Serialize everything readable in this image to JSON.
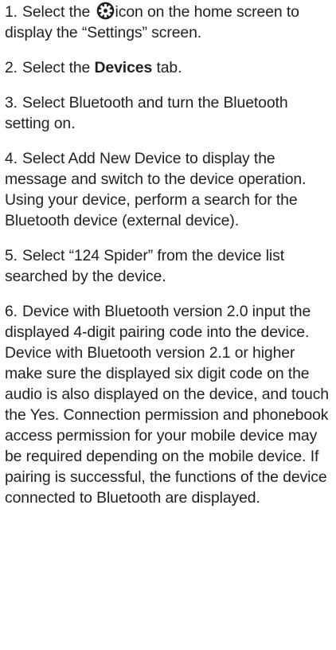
{
  "steps": [
    {
      "num": "1.",
      "pre": "Select the",
      "icon": "settings-gear-icon",
      "post": "icon on the home screen to display the “Settings” screen."
    },
    {
      "num": "2.",
      "pre": "Select the",
      "bold": "Devices",
      "post": "tab."
    },
    {
      "num": "3.",
      "text": "Select Bluetooth and turn the Bluetooth setting on."
    },
    {
      "num": "4.",
      "text": "Select Add New Device to display the message and switch to the device operation. Using your device, perform a search for the Bluetooth device (external device)."
    },
    {
      "num": "5.",
      "text": "Select “124 Spider” from the device list searched by the device."
    },
    {
      "num": "6.",
      "text": "Device with Bluetooth version 2.0 input the displayed 4-digit pairing code into the device. Device with Bluetooth version 2.1 or higher make sure the displayed six digit code on the audio is also displayed on the device, and touch the Yes. Connection permission and phonebook access permission for your mobile device may be required depending on the mobile device. If pairing is successful, the functions of the device connected to Bluetooth are displayed."
    }
  ],
  "colors": {
    "text": "#231f20",
    "background": "#ffffff"
  }
}
